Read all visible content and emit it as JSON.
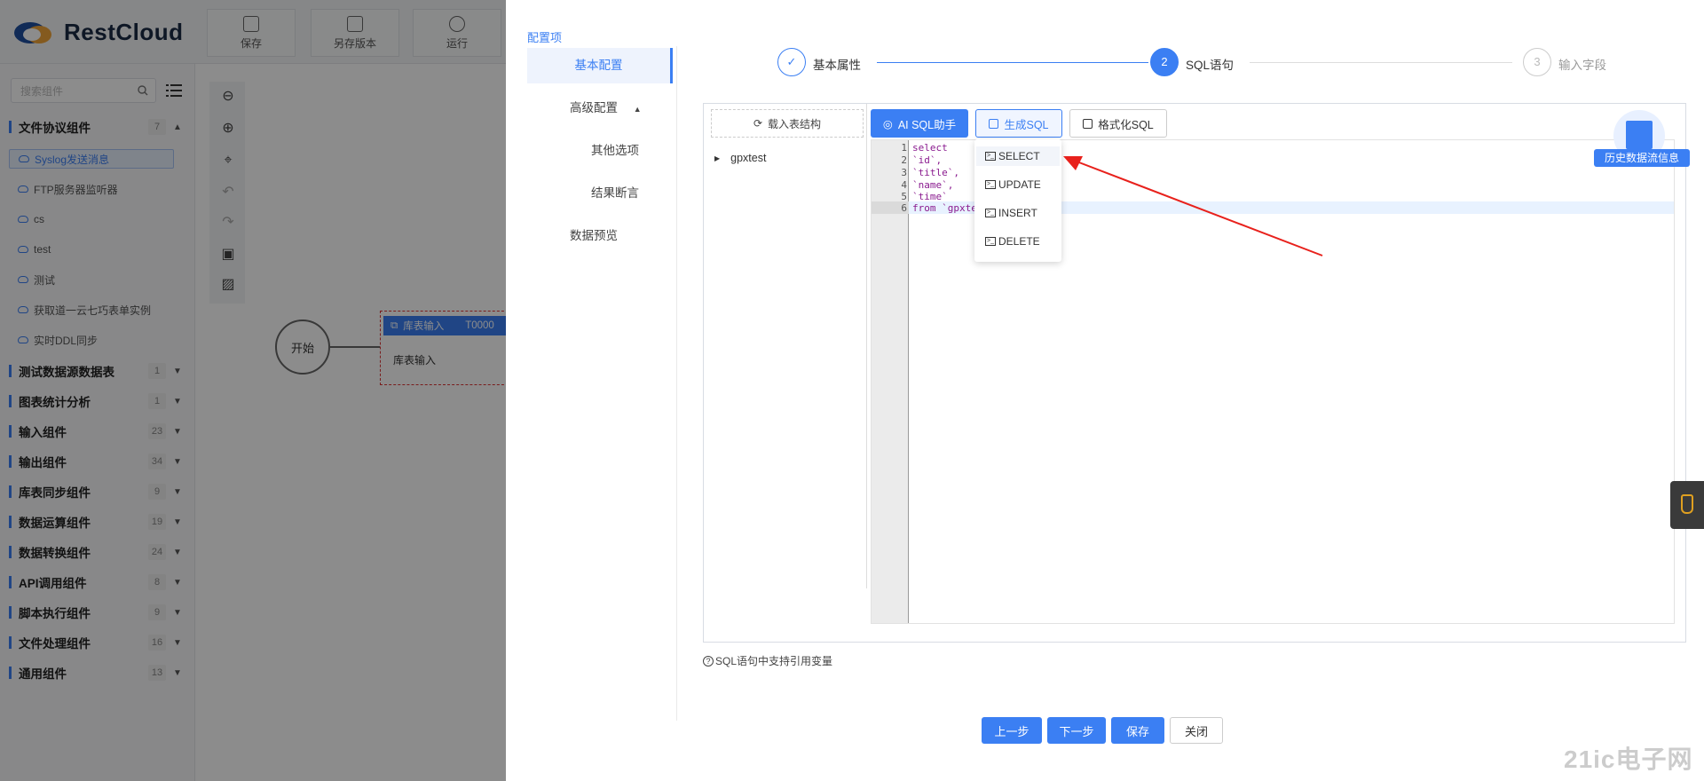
{
  "app": {
    "brand": "RestCloud",
    "toolbar": {
      "save": "保存",
      "save_version": "另存版本",
      "run": "运行"
    }
  },
  "sidebar": {
    "search_placeholder": "搜索组件",
    "categories": [
      {
        "name": "文件协议组件",
        "count": "7"
      },
      {
        "name": "测试数据源数据表",
        "count": "1"
      },
      {
        "name": "图表统计分析",
        "count": "1"
      },
      {
        "name": "输入组件",
        "count": "23"
      },
      {
        "name": "输出组件",
        "count": "34"
      },
      {
        "name": "库表同步组件",
        "count": "9"
      },
      {
        "name": "数据运算组件",
        "count": "19"
      },
      {
        "name": "数据转换组件",
        "count": "24"
      },
      {
        "name": "API调用组件",
        "count": "8"
      },
      {
        "name": "脚本执行组件",
        "count": "9"
      },
      {
        "name": "文件处理组件",
        "count": "16"
      },
      {
        "name": "通用组件",
        "count": "13"
      }
    ],
    "sub_items": [
      "Syslog发送消息",
      "FTP服务器监听器",
      "cs",
      "test",
      "测试",
      "获取道一云七巧表单实例",
      "实时DDL同步"
    ]
  },
  "canvas": {
    "start_node": "开始",
    "task_node": {
      "header": "库表输入",
      "id": "T0000",
      "body": "库表输入"
    }
  },
  "drawer": {
    "title": "配置项",
    "nav": {
      "basic": "基本配置",
      "advanced": "高级配置",
      "other": "其他选项",
      "assert": "结果断言",
      "preview": "数据预览"
    },
    "steps": [
      {
        "num": "✓",
        "label": "基本属性"
      },
      {
        "num": "2",
        "label": "SQL语句"
      },
      {
        "num": "3",
        "label": "输入字段"
      }
    ],
    "load_structure": "载入表结构",
    "tree_root": "gpxtest",
    "buttons": {
      "ai": "AI SQL助手",
      "generate": "生成SQL",
      "format": "格式化SQL"
    },
    "code_lines": [
      "select",
      "`id`,",
      "`title`,",
      "`name`,",
      "`time`",
      "from `gpxte"
    ],
    "dropdown": [
      "SELECT",
      "UPDATE",
      "INSERT",
      "DELETE"
    ],
    "history_label": "历史数据流信息",
    "hint": "SQL语句中支持引用变量",
    "footer": {
      "prev": "上一步",
      "next": "下一步",
      "save": "保存",
      "close": "关闭"
    }
  },
  "watermark": "21ic电子网",
  "colors": {
    "accent": "#3b7ff3",
    "annotation_arrow": "#e8211c"
  }
}
